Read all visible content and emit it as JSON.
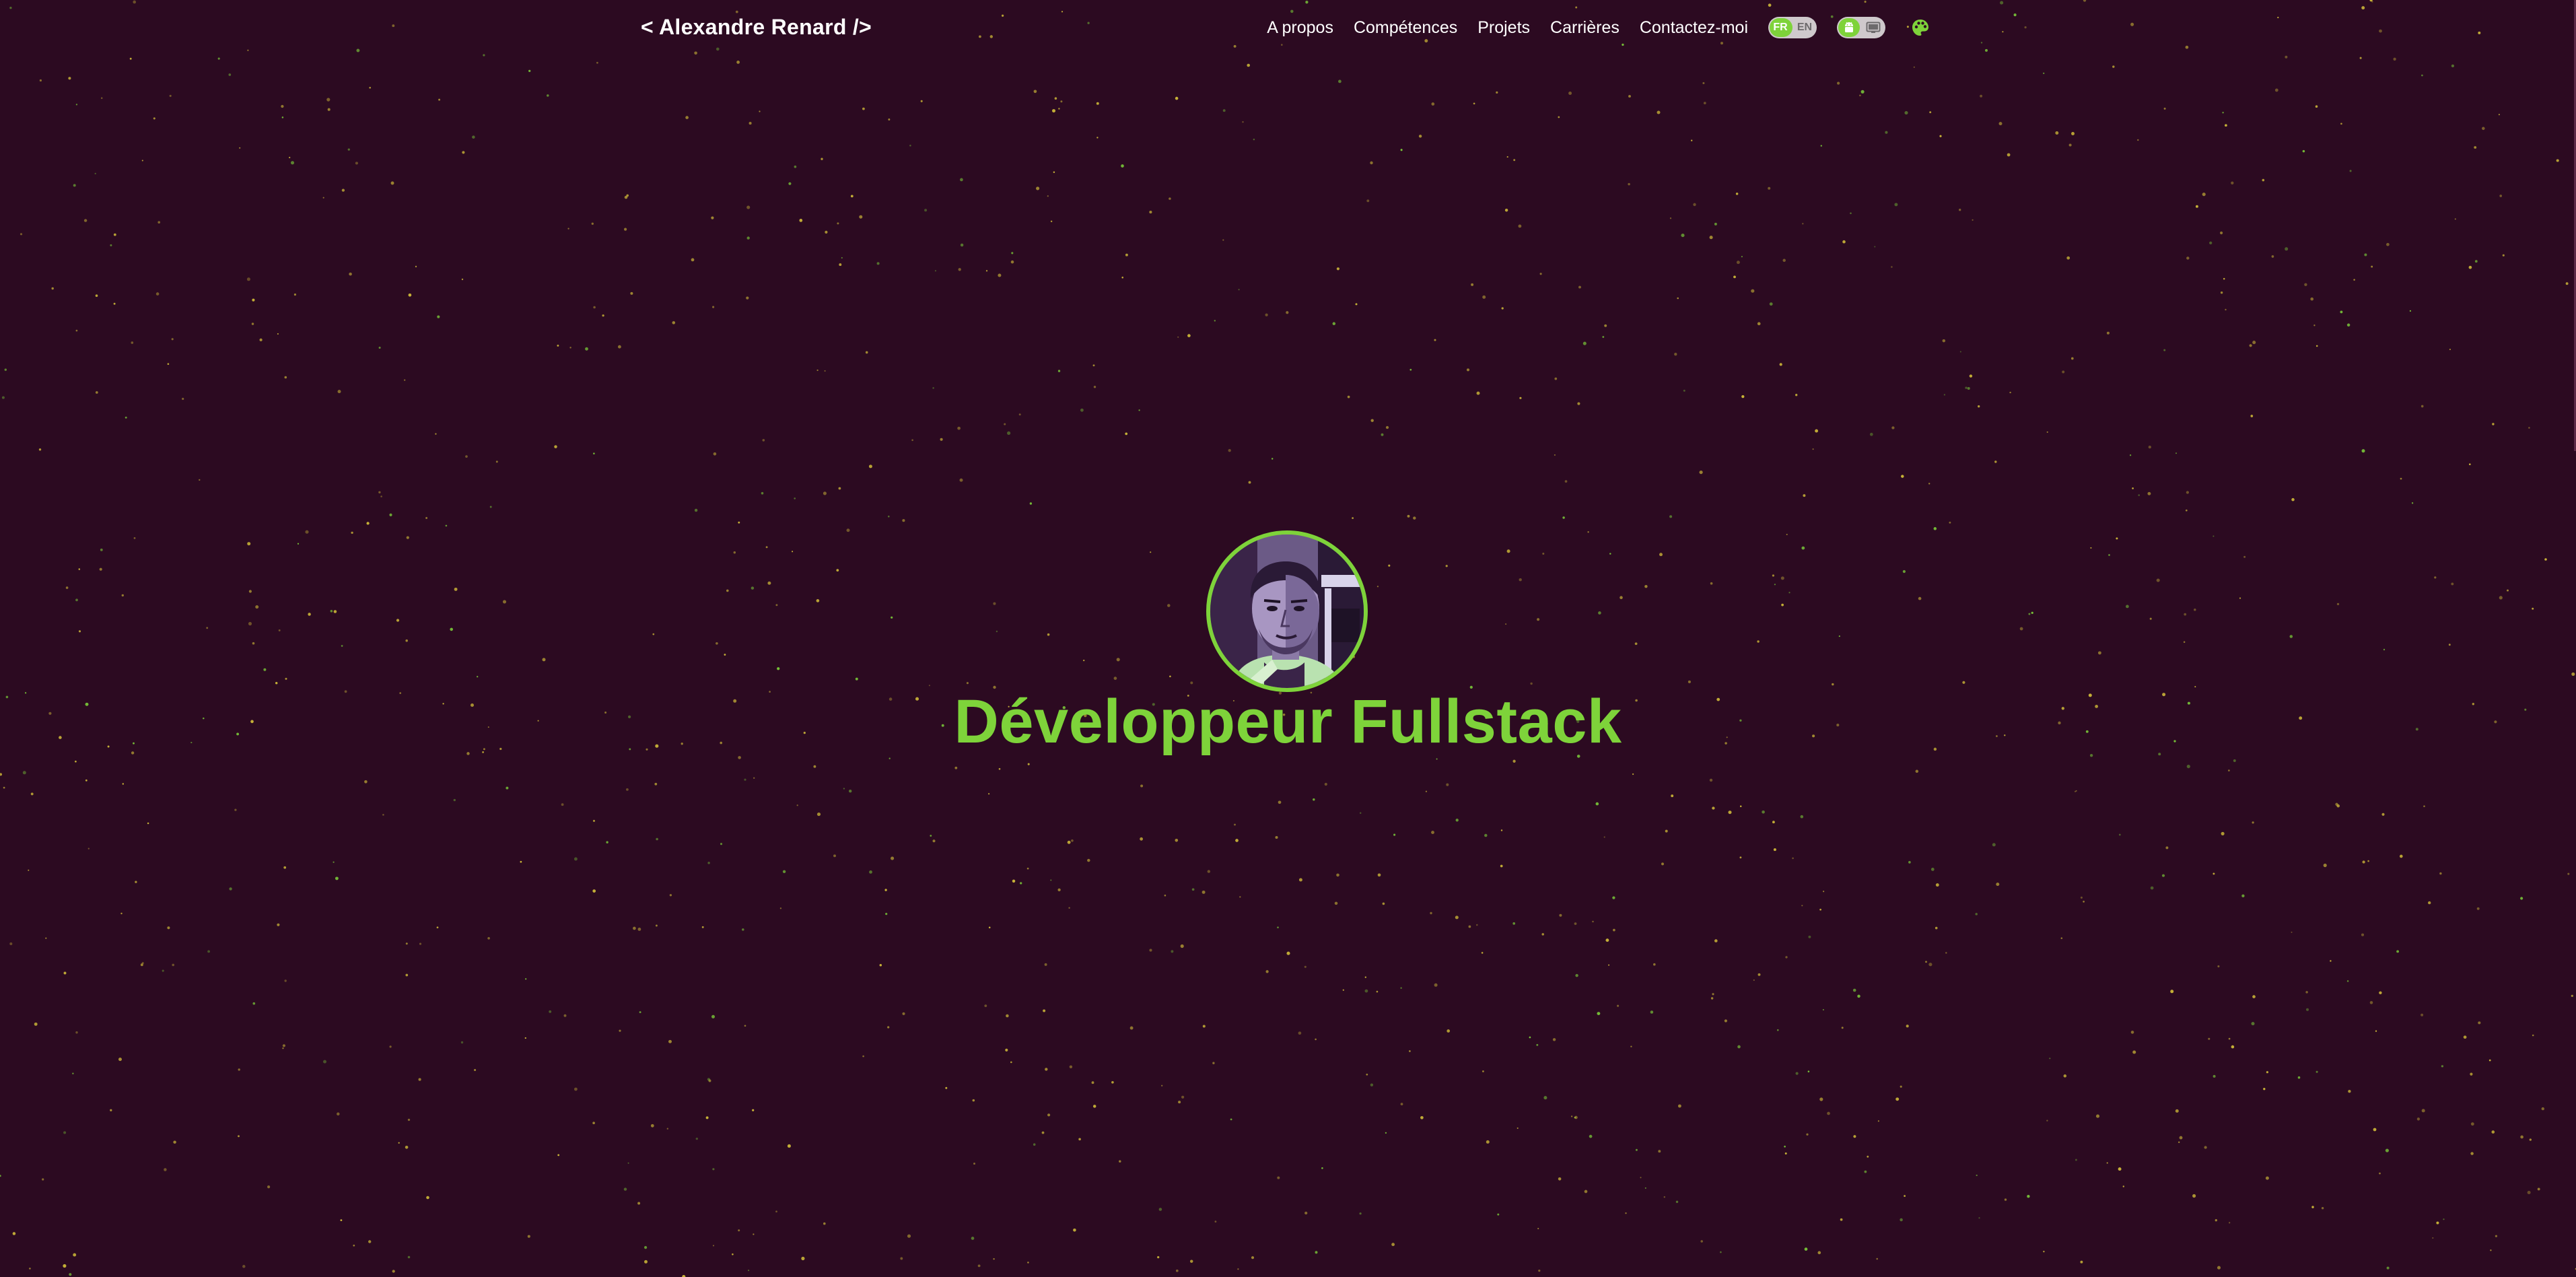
{
  "header": {
    "brand": "< Alexandre Renard />",
    "nav": [
      {
        "label": "A propos"
      },
      {
        "label": "Compétences"
      },
      {
        "label": "Projets"
      },
      {
        "label": "Carrières"
      },
      {
        "label": "Contactez-moi"
      }
    ],
    "language_toggle": {
      "selected": "FR",
      "options": [
        "FR",
        "EN"
      ]
    },
    "theme_toggle": {
      "left_icon": "android-icon",
      "right_icon": "desktop-icon"
    },
    "palette_icon": "palette-icon"
  },
  "hero": {
    "title": "Développeur Fullstack",
    "avatar_icon": "avatar-photo"
  },
  "colors": {
    "background": "#2c0a21",
    "accent": "#7ed33a",
    "text": "#ffffff",
    "toggle_track": "#cfc9cc",
    "star": "#d9c53a"
  }
}
